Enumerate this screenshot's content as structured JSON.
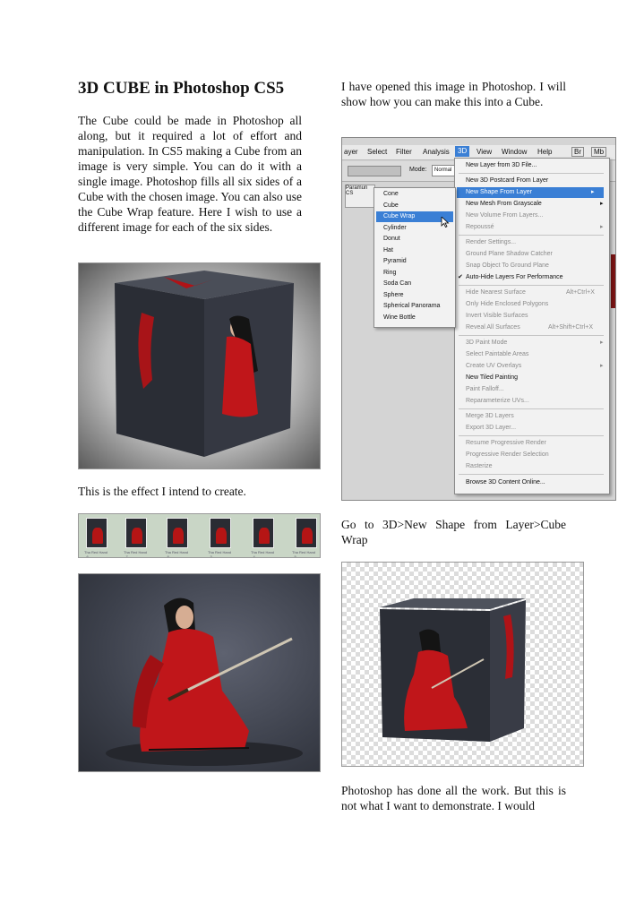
{
  "doc": {
    "title": "3D CUBE in Photoshop CS5",
    "intro": "The Cube could be made in Photoshop all along, but it required a lot of effort and manipulation. In CS5 making a Cube from an image is very simple. You can do it with a single image. Photoshop fills all six sides of a Cube with the chosen image. You can also use the Cube Wrap feature. Here I wish to use a different image for each of the six sides.",
    "caption_effect": "This is the effect I intend to create.",
    "opened_text": "I have opened this image in Photoshop. I will show how you can make this into a Cube.",
    "instruction": "Go to 3D>New Shape from Layer>Cube Wrap",
    "closing": "Photoshop has done all the work. But this is not what I want to demonstrate. I would"
  },
  "thumbnails": [
    "Tha Red Hand - 6",
    "Tha Red Hand - 7",
    "Tha Red Hand - 8",
    "Tha Red Hand - 3",
    "Tha Red Hand - 4",
    "Tha Red Hand - 5"
  ],
  "photoshop": {
    "menubar": [
      "ayer",
      "Select",
      "Filter",
      "Analysis",
      "3D",
      "View",
      "Window",
      "Help",
      "Br",
      "Mb"
    ],
    "mode_label": "Mode:",
    "mode_value": "Normal",
    "layers_label": "Paramun",
    "layers_value": "CS",
    "menu_3d": [
      {
        "label": "New Layer from 3D File...",
        "state": "normal"
      },
      {
        "label": "New 3D Postcard From Layer",
        "state": "normal"
      },
      {
        "label": "New Shape From Layer",
        "state": "highlight",
        "arrow": "▸"
      },
      {
        "label": "New Mesh From Grayscale",
        "state": "normal",
        "arrow": "▸"
      },
      {
        "label": "New Volume From Layers...",
        "state": "disabled"
      },
      {
        "label": "Repoussé",
        "state": "disabled",
        "arrow": "▸"
      },
      {
        "label": "Render Settings...",
        "state": "disabled"
      },
      {
        "label": "Ground Plane Shadow Catcher",
        "state": "disabled"
      },
      {
        "label": "Snap Object To Ground Plane",
        "state": "disabled"
      },
      {
        "label": "Auto-Hide Layers For Performance",
        "state": "checked",
        "check": "✔"
      },
      {
        "label": "Hide Nearest Surface",
        "state": "disabled",
        "shortcut": "Alt+Ctrl+X"
      },
      {
        "label": "Only Hide Enclosed Polygons",
        "state": "disabled"
      },
      {
        "label": "Invert Visible Surfaces",
        "state": "disabled"
      },
      {
        "label": "Reveal All Surfaces",
        "state": "disabled",
        "shortcut": "Alt+Shift+Ctrl+X"
      },
      {
        "label": "3D Paint Mode",
        "state": "disabled",
        "arrow": "▸"
      },
      {
        "label": "Select Paintable Areas",
        "state": "disabled"
      },
      {
        "label": "Create UV Overlays",
        "state": "disabled",
        "arrow": "▸"
      },
      {
        "label": "New Tiled Painting",
        "state": "normal"
      },
      {
        "label": "Paint Falloff...",
        "state": "disabled"
      },
      {
        "label": "Reparameterize UVs...",
        "state": "disabled"
      },
      {
        "label": "Merge 3D Layers",
        "state": "disabled"
      },
      {
        "label": "Export 3D Layer...",
        "state": "disabled"
      },
      {
        "label": "Resume Progressive Render",
        "state": "disabled"
      },
      {
        "label": "Progressive Render Selection",
        "state": "disabled"
      },
      {
        "label": "Rasterize",
        "state": "disabled"
      },
      {
        "label": "Browse 3D Content Online...",
        "state": "normal"
      }
    ],
    "submenu": [
      {
        "label": "Cone",
        "state": "normal"
      },
      {
        "label": "Cube",
        "state": "normal"
      },
      {
        "label": "Cube Wrap",
        "state": "highlight"
      },
      {
        "label": "Cylinder",
        "state": "normal"
      },
      {
        "label": "Donut",
        "state": "normal"
      },
      {
        "label": "Hat",
        "state": "normal"
      },
      {
        "label": "Pyramid",
        "state": "normal"
      },
      {
        "label": "Ring",
        "state": "normal"
      },
      {
        "label": "Soda Can",
        "state": "normal"
      },
      {
        "label": "Sphere",
        "state": "normal"
      },
      {
        "label": "Spherical Panorama",
        "state": "normal"
      },
      {
        "label": "Wine Bottle",
        "state": "normal"
      }
    ]
  },
  "colors": {
    "highlight": "#3a7fd5",
    "dress_red": "#c0161a",
    "cube_dark": "#2b2e36"
  }
}
